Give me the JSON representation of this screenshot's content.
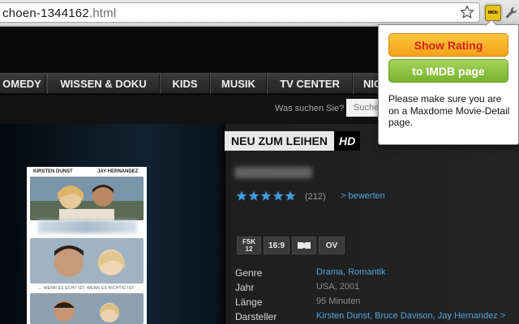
{
  "browser": {
    "url_prefix": "choen-1344162",
    "url_suffix": ".html",
    "extension_icon_text": "IMDb"
  },
  "nav": {
    "items": [
      {
        "label": "OMEDY"
      },
      {
        "label": "WISSEN & DOKU"
      },
      {
        "label": "KIDS"
      },
      {
        "label": "MUSIK"
      },
      {
        "label": "TV CENTER"
      },
      {
        "label": "NIC"
      }
    ]
  },
  "search": {
    "label": "Was suchen Sie?",
    "placeholder": "Suche"
  },
  "movie": {
    "badge_label": "NEU ZUM LEIHEN",
    "badge_hd": "HD",
    "rating_stars": 5,
    "rating_count": "(212)",
    "rate_link": "> bewerten",
    "formats": {
      "fsk_top": "FSK",
      "fsk_bottom": "12",
      "aspect": "16:9",
      "language": "OV"
    },
    "poster": {
      "actor_left": "KIRSTEN DUNST",
      "actor_right": "JAY HERNANDEZ",
      "tagline": "... WENN ES ECHT IST, WENN ES RICHTIG IST."
    },
    "details": [
      {
        "key": "Genre",
        "value": "Drama, Romantik",
        "link": true
      },
      {
        "key": "Jahr",
        "value": "USA, 2001",
        "link": false
      },
      {
        "key": "Länge",
        "value": "95 Minuten",
        "link": false
      },
      {
        "key": "Darsteller",
        "value": "Kirsten Dunst, Bruce Davison, Jay Hernandez >",
        "link": true
      }
    ]
  },
  "popup": {
    "show_rating_label": "Show Rating",
    "imdb_page_label": "to IMDB page",
    "message": "Please make sure you are on a Maxdome Movie-Detail page."
  },
  "colors": {
    "link_blue": "#4ea6e0",
    "star_blue": "#3f9be0",
    "rating_button": "#f5a21a",
    "imdb_button": "#79b22d"
  }
}
